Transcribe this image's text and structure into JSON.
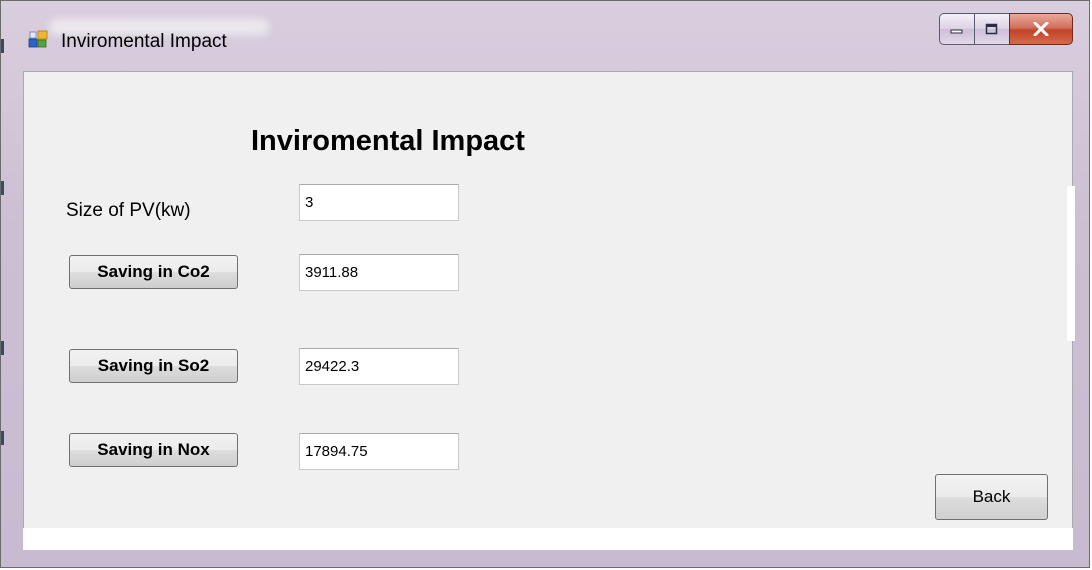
{
  "window": {
    "title": "Inviromental Impact",
    "caption_icons": [
      "minimize-icon",
      "maximize-icon",
      "close-icon"
    ]
  },
  "form": {
    "heading": "Inviromental Impact",
    "pv_size": {
      "label": "Size of PV(kw)",
      "value": "3"
    },
    "co2": {
      "button_label": "Saving in Co2",
      "value": "3911.88"
    },
    "so2": {
      "button_label": "Saving in So2",
      "value": "29422.3"
    },
    "nox": {
      "button_label": "Saving in Nox",
      "value": "17894.75"
    },
    "back_label": "Back"
  },
  "colors": {
    "titlebar": "#cdbfd3",
    "client_background": "#f0f0f0",
    "close_button": "#c1432a"
  }
}
